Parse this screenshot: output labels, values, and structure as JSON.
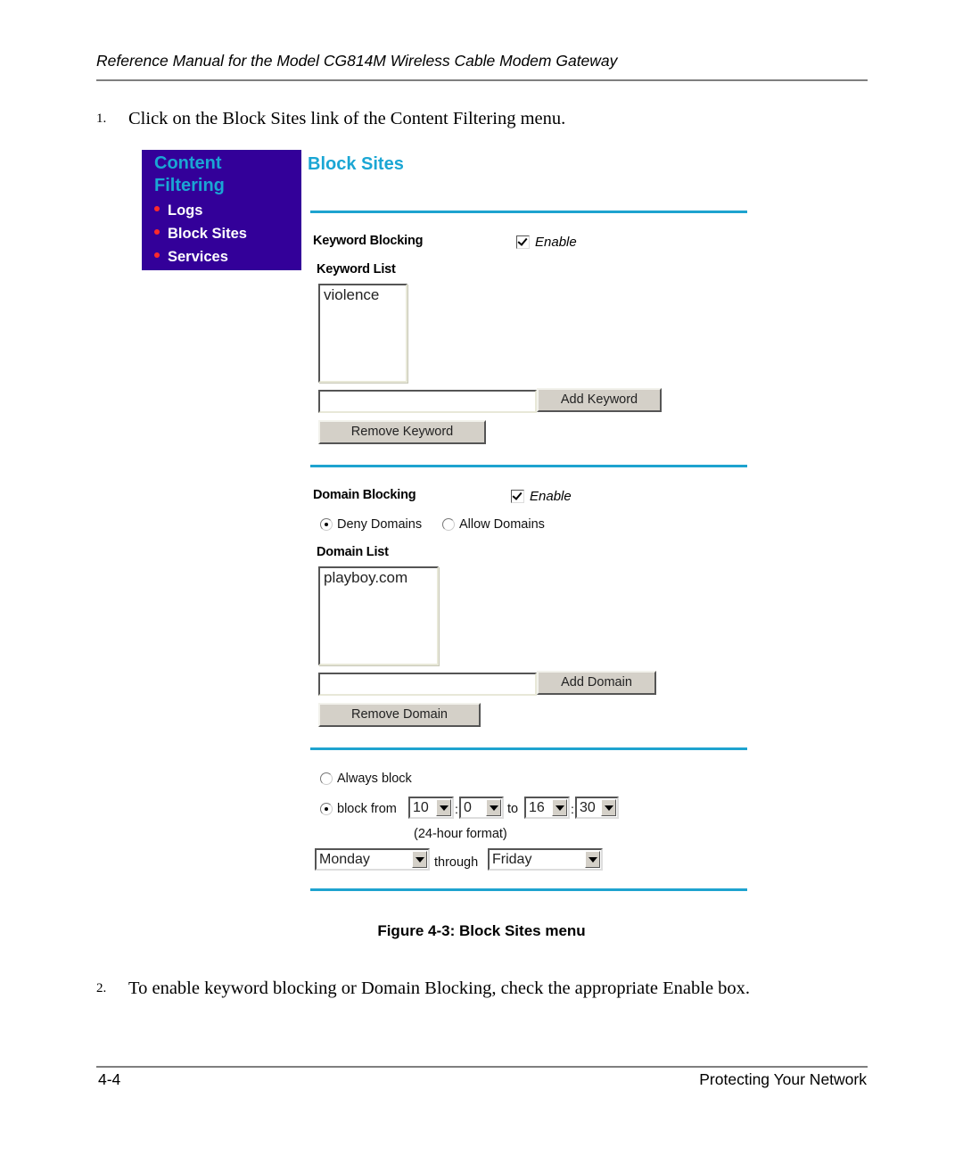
{
  "document": {
    "running_head": "Reference Manual for the Model CG814M Wireless Cable Modem Gateway",
    "steps": [
      {
        "number": "1.",
        "text": "Click on the Block Sites link of the Content Filtering menu."
      },
      {
        "number": "2.",
        "text": "To enable keyword blocking or Domain Blocking, check the appropriate Enable box."
      }
    ],
    "figure_caption": "Figure 4-3: Block Sites menu",
    "footer": {
      "page_number": "4-4",
      "chapter": "Protecting Your Network"
    }
  },
  "sidebar": {
    "title_line1": "Content",
    "title_line2": "Filtering",
    "items": [
      {
        "label": "Logs"
      },
      {
        "label": "Block Sites"
      },
      {
        "label": "Services"
      }
    ]
  },
  "screen": {
    "title": "Block Sites",
    "keyword": {
      "label": "Keyword Blocking",
      "enable_label": "Enable",
      "enabled": true,
      "list_label": "Keyword List",
      "list_items": [
        "violence"
      ],
      "input_value": "",
      "add_button": "Add Keyword",
      "remove_button": "Remove Keyword"
    },
    "domain": {
      "label": "Domain Blocking",
      "enable_label": "Enable",
      "enabled": true,
      "mode_options": [
        {
          "label": "Deny Domains",
          "selected": true
        },
        {
          "label": "Allow Domains",
          "selected": false
        }
      ],
      "list_label": "Domain List",
      "list_items": [
        "playboy.com"
      ],
      "input_value": "",
      "add_button": "Add Domain",
      "remove_button": "Remove Domain"
    },
    "schedule": {
      "always_label": "Always block",
      "always_selected": false,
      "from_label": "block from",
      "from_selected": true,
      "from_hour": "10",
      "from_minute": "0",
      "to_label": "to",
      "to_hour": "16",
      "to_minute": "30",
      "colon": ":",
      "format_note": "(24-hour format)",
      "day_start": "Monday",
      "through_label": "through",
      "day_end": "Friday"
    }
  },
  "colors": {
    "sidebar_bg": "#330099",
    "accent": "#1aa6d4",
    "bullet": "#ff2a2a",
    "button_face": "#d4d0c8"
  }
}
